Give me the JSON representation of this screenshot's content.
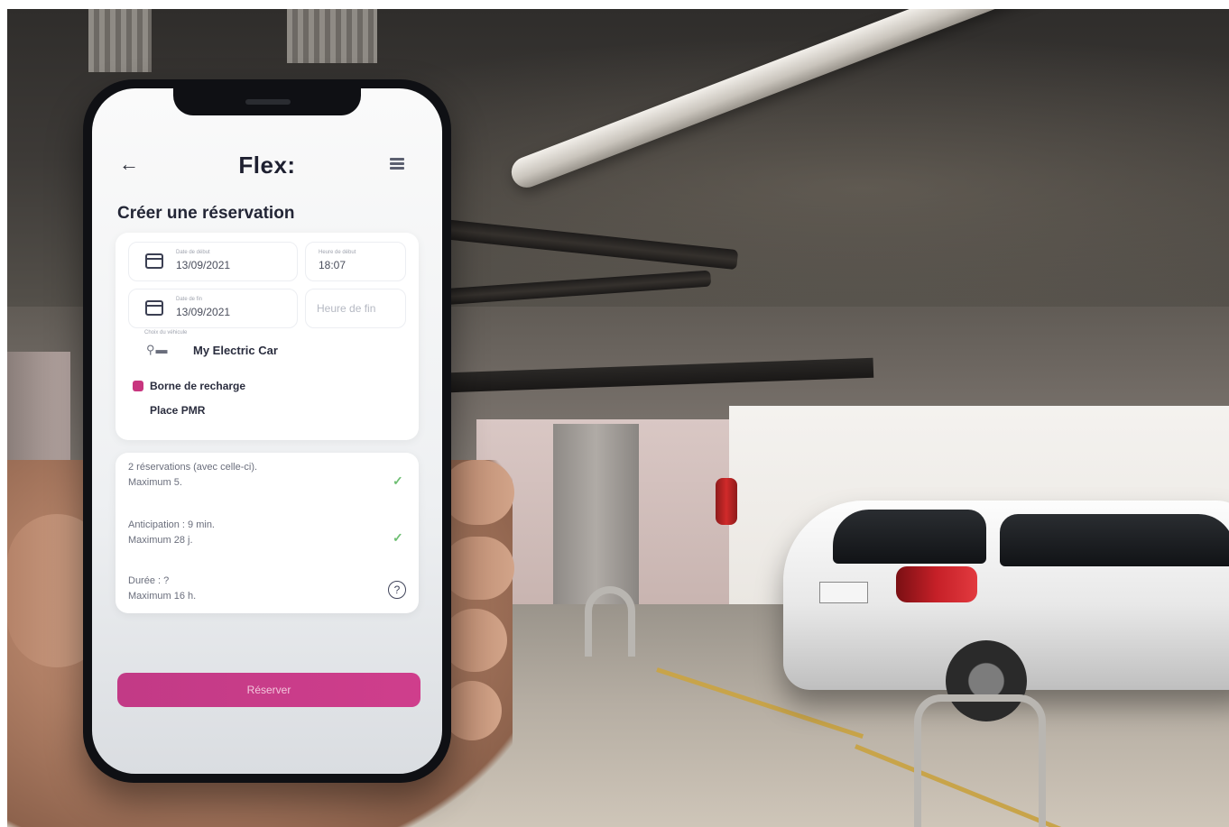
{
  "app": {
    "logo": "Flex:",
    "back_icon": "arrow-left-icon",
    "menu_icon": "hamburger-menu-icon"
  },
  "page": {
    "title": "Créer une réservation"
  },
  "form": {
    "start_date": {
      "label": "Date de début",
      "value": "13/09/2021"
    },
    "start_time": {
      "label": "Heure de début",
      "value": "18:07"
    },
    "end_date": {
      "label": "Date de fin",
      "value": "13/09/2021"
    },
    "end_time": {
      "placeholder": "Heure de fin"
    },
    "vehicle": {
      "label": "Choix du véhicule",
      "value": "My Electric Car",
      "icon": "car-icon"
    },
    "options": [
      {
        "label": "Borne de recharge",
        "checked": true
      },
      {
        "label": "Place PMR",
        "checked": false
      }
    ]
  },
  "rules": [
    {
      "line1": "2 réservations (avec celle-ci).",
      "line2": "Maximum 5.",
      "status": "check"
    },
    {
      "line1": "Anticipation : 9 min.",
      "line2": "Maximum 28 j.",
      "status": "check"
    },
    {
      "line1": "Durée : ?",
      "line2": "Maximum 16 h.",
      "status": "help"
    }
  ],
  "actions": {
    "reserve_label": "Réserver"
  },
  "colors": {
    "accent": "#c8357f",
    "check": "#6fbf73",
    "text_dark": "#232636"
  }
}
